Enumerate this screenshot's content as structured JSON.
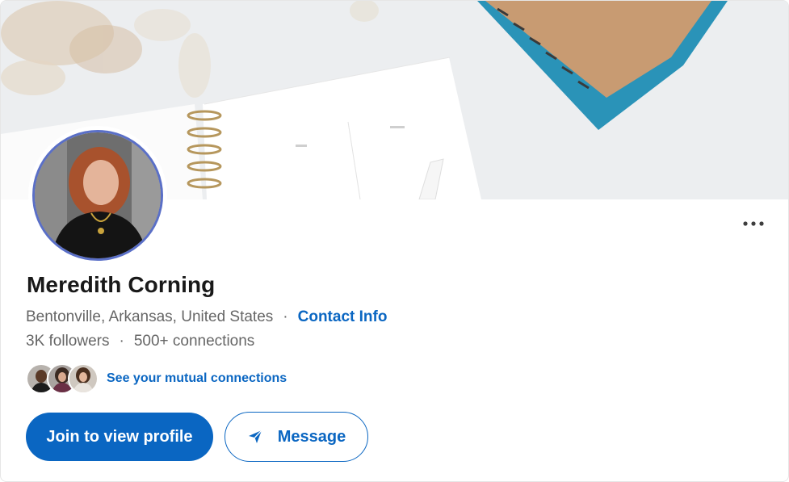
{
  "profile": {
    "name": "Meredith Corning",
    "location": "Bentonville, Arkansas, United States",
    "contact_label": "Contact Info",
    "separator": "·",
    "followers": "3K followers",
    "connections": "500+ connections",
    "mutual_label": "See your mutual connections"
  },
  "actions": {
    "primary_label": "Join to view profile",
    "secondary_label": "Message",
    "more_icon": "more-options-icon",
    "send_icon": "send-icon"
  },
  "colors": {
    "accent": "#0a66c2",
    "text": "#191919",
    "muted": "#666666"
  }
}
